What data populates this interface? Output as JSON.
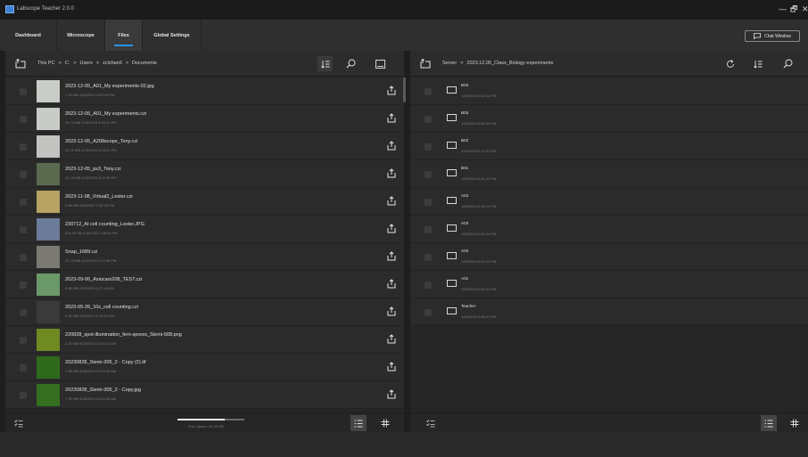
{
  "app": {
    "title": "Labscope Teacher 2.0.0"
  },
  "window": {
    "minimize": "—",
    "maximize": "🗗",
    "close": "✕"
  },
  "tabs": [
    {
      "label": "Dashboard"
    },
    {
      "label": "Microscope"
    },
    {
      "label": "Files",
      "active": true
    },
    {
      "label": "Global Settings"
    }
  ],
  "chat_button": {
    "label": "Chat Window"
  },
  "left": {
    "breadcrumb": [
      "This PC",
      ">",
      "C:",
      ">",
      "Users",
      ">",
      "zclzhan9",
      ">",
      "Documents"
    ],
    "files": [
      {
        "name": "2023-12-05_A01_My experiments-02.jpg",
        "meta": "1.94 MB  12/5/2023 4:53:40 PM",
        "thumb": "#c9cdc7"
      },
      {
        "name": "2023-12-05_A01_My experiments.czi",
        "meta": "15.70 MB  12/5/2023 4:32:41 PM",
        "thumb": "#c8ccc6"
      },
      {
        "name": "2023-12-05_A208scope_Tony.czi",
        "meta": "23.71 MB  12/5/2023 3:04:41 PM",
        "thumb": "#c2c2c0"
      },
      {
        "name": "2023-12-05_ps3_Tony.czi",
        "meta": "23.75 MB  12/5/2023 3:02:38 PM",
        "thumb": "#5a6a4e"
      },
      {
        "name": "2023-11-08_Virtual2_Lester.czi",
        "meta": "3.86 MB  11/8/2023 7:49:56 PM",
        "thumb": "#b8a264"
      },
      {
        "name": "230712_AI cell counting_Lester.JPG",
        "meta": "630.05 KB  11/8/2023 7:48:06 PM",
        "thumb": "#6b7b98"
      },
      {
        "name": "Snap_1689.czi",
        "meta": "22.74 MB  11/3/2023 2:13:36 PM",
        "thumb": "#7a7a72"
      },
      {
        "name": "2023-09-06_Axiocam208_TEST.czi",
        "meta": "6.88 MB  9/6/2023 11:27:44 AM",
        "thumb": "#6a9868"
      },
      {
        "name": "2023-05-26_10x_cell counting.czi",
        "meta": "6.00 MB  9/6/2023 11:23:26 AM",
        "thumb": "#3a3a3a"
      },
      {
        "name": "220828_spot-illumination_fern-spores_Stemi-508.png",
        "meta": "3.25 MB  9/28/2023 11:34:01 AM",
        "thumb": "#6f8a22"
      },
      {
        "name": "20230828_Stemi-305_2 - Copy (2).tif",
        "meta": "7.86 MB  9/28/2023 11:23:26 AM",
        "thumb": "#2f6a1c"
      },
      {
        "name": "20230828_Stemi-305_2 - Copy.jpg",
        "meta": "7.99 MB  9/28/2023 11:23:25 AM",
        "thumb": "#346e1e"
      }
    ],
    "free_space": {
      "label": "Free Space: 35.29 GB",
      "used_fraction": 0.7
    }
  },
  "right": {
    "breadcrumb": [
      "Server",
      ">",
      "2023.12.05_Class_Biology experiments"
    ],
    "folders": [
      {
        "name": "B04",
        "meta": "12/5/2023 5:52:44 PM"
      },
      {
        "name": "B03",
        "meta": "12/5/2023 5:50:30 PM"
      },
      {
        "name": "B02",
        "meta": "12/5/2023 5:32:02 PM"
      },
      {
        "name": "B01",
        "meta": "12/5/2023 5:31:49 PM"
      },
      {
        "name": "A04",
        "meta": "12/5/2023 5:30:10 PM"
      },
      {
        "name": "A03",
        "meta": "12/5/2023 5:29:49 PM"
      },
      {
        "name": "A02",
        "meta": "12/5/2023 5:09:29 PM"
      },
      {
        "name": "A01",
        "meta": "12/5/2023 4:48:41 PM"
      },
      {
        "name": "Teacher",
        "meta": "12/5/2023 4:48:41 PM"
      }
    ]
  },
  "colors": {
    "accent": "#2a93e8",
    "background": "#1e1e1e",
    "panel": "#262626",
    "row": "#2b2b2b"
  },
  "icons": [
    "folder-up-icon",
    "sort-icon",
    "search-image-icon",
    "gallery-icon",
    "refresh-icon",
    "upload-icon",
    "select-all-icon",
    "list-view-icon",
    "grid-view-icon",
    "chat-icon"
  ]
}
